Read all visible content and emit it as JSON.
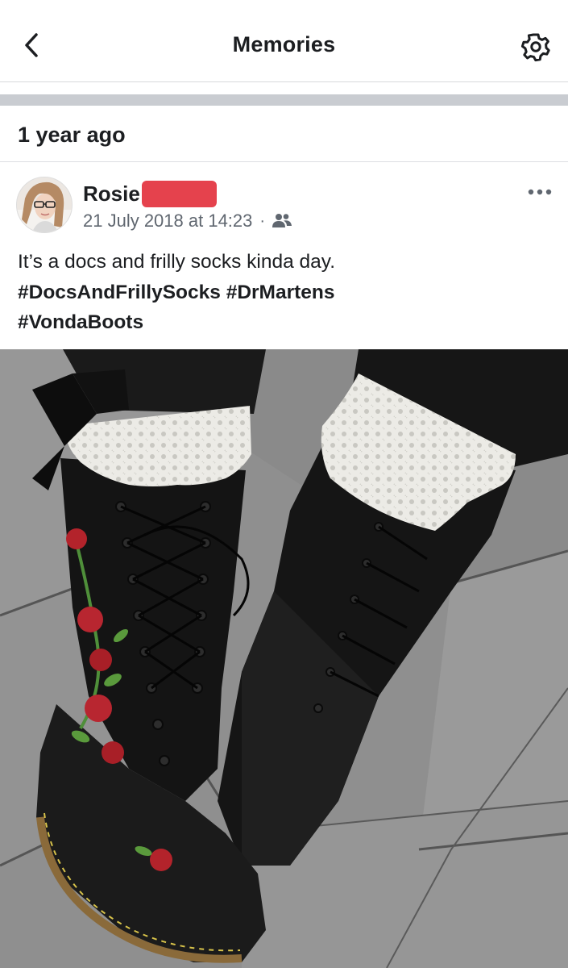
{
  "navbar": {
    "title": "Memories",
    "back_icon": "chevron-left-icon",
    "settings_icon": "gear-icon"
  },
  "section": {
    "title": "1 year ago"
  },
  "post": {
    "author": "Rosie",
    "timestamp": "21 July 2018 at 14:23",
    "separator": "·",
    "audience_icon": "friends-icon",
    "more_icon": "more-horizontal-icon",
    "text_line1": "It’s a docs and frilly socks kinda day.",
    "text_line2": "#DocsAndFrillySocks #DrMartens",
    "text_line3": "#VondaBoots"
  },
  "colors": {
    "redaction": "#e5424d",
    "meta_text": "#606770",
    "separator": "#c9ccd1"
  }
}
